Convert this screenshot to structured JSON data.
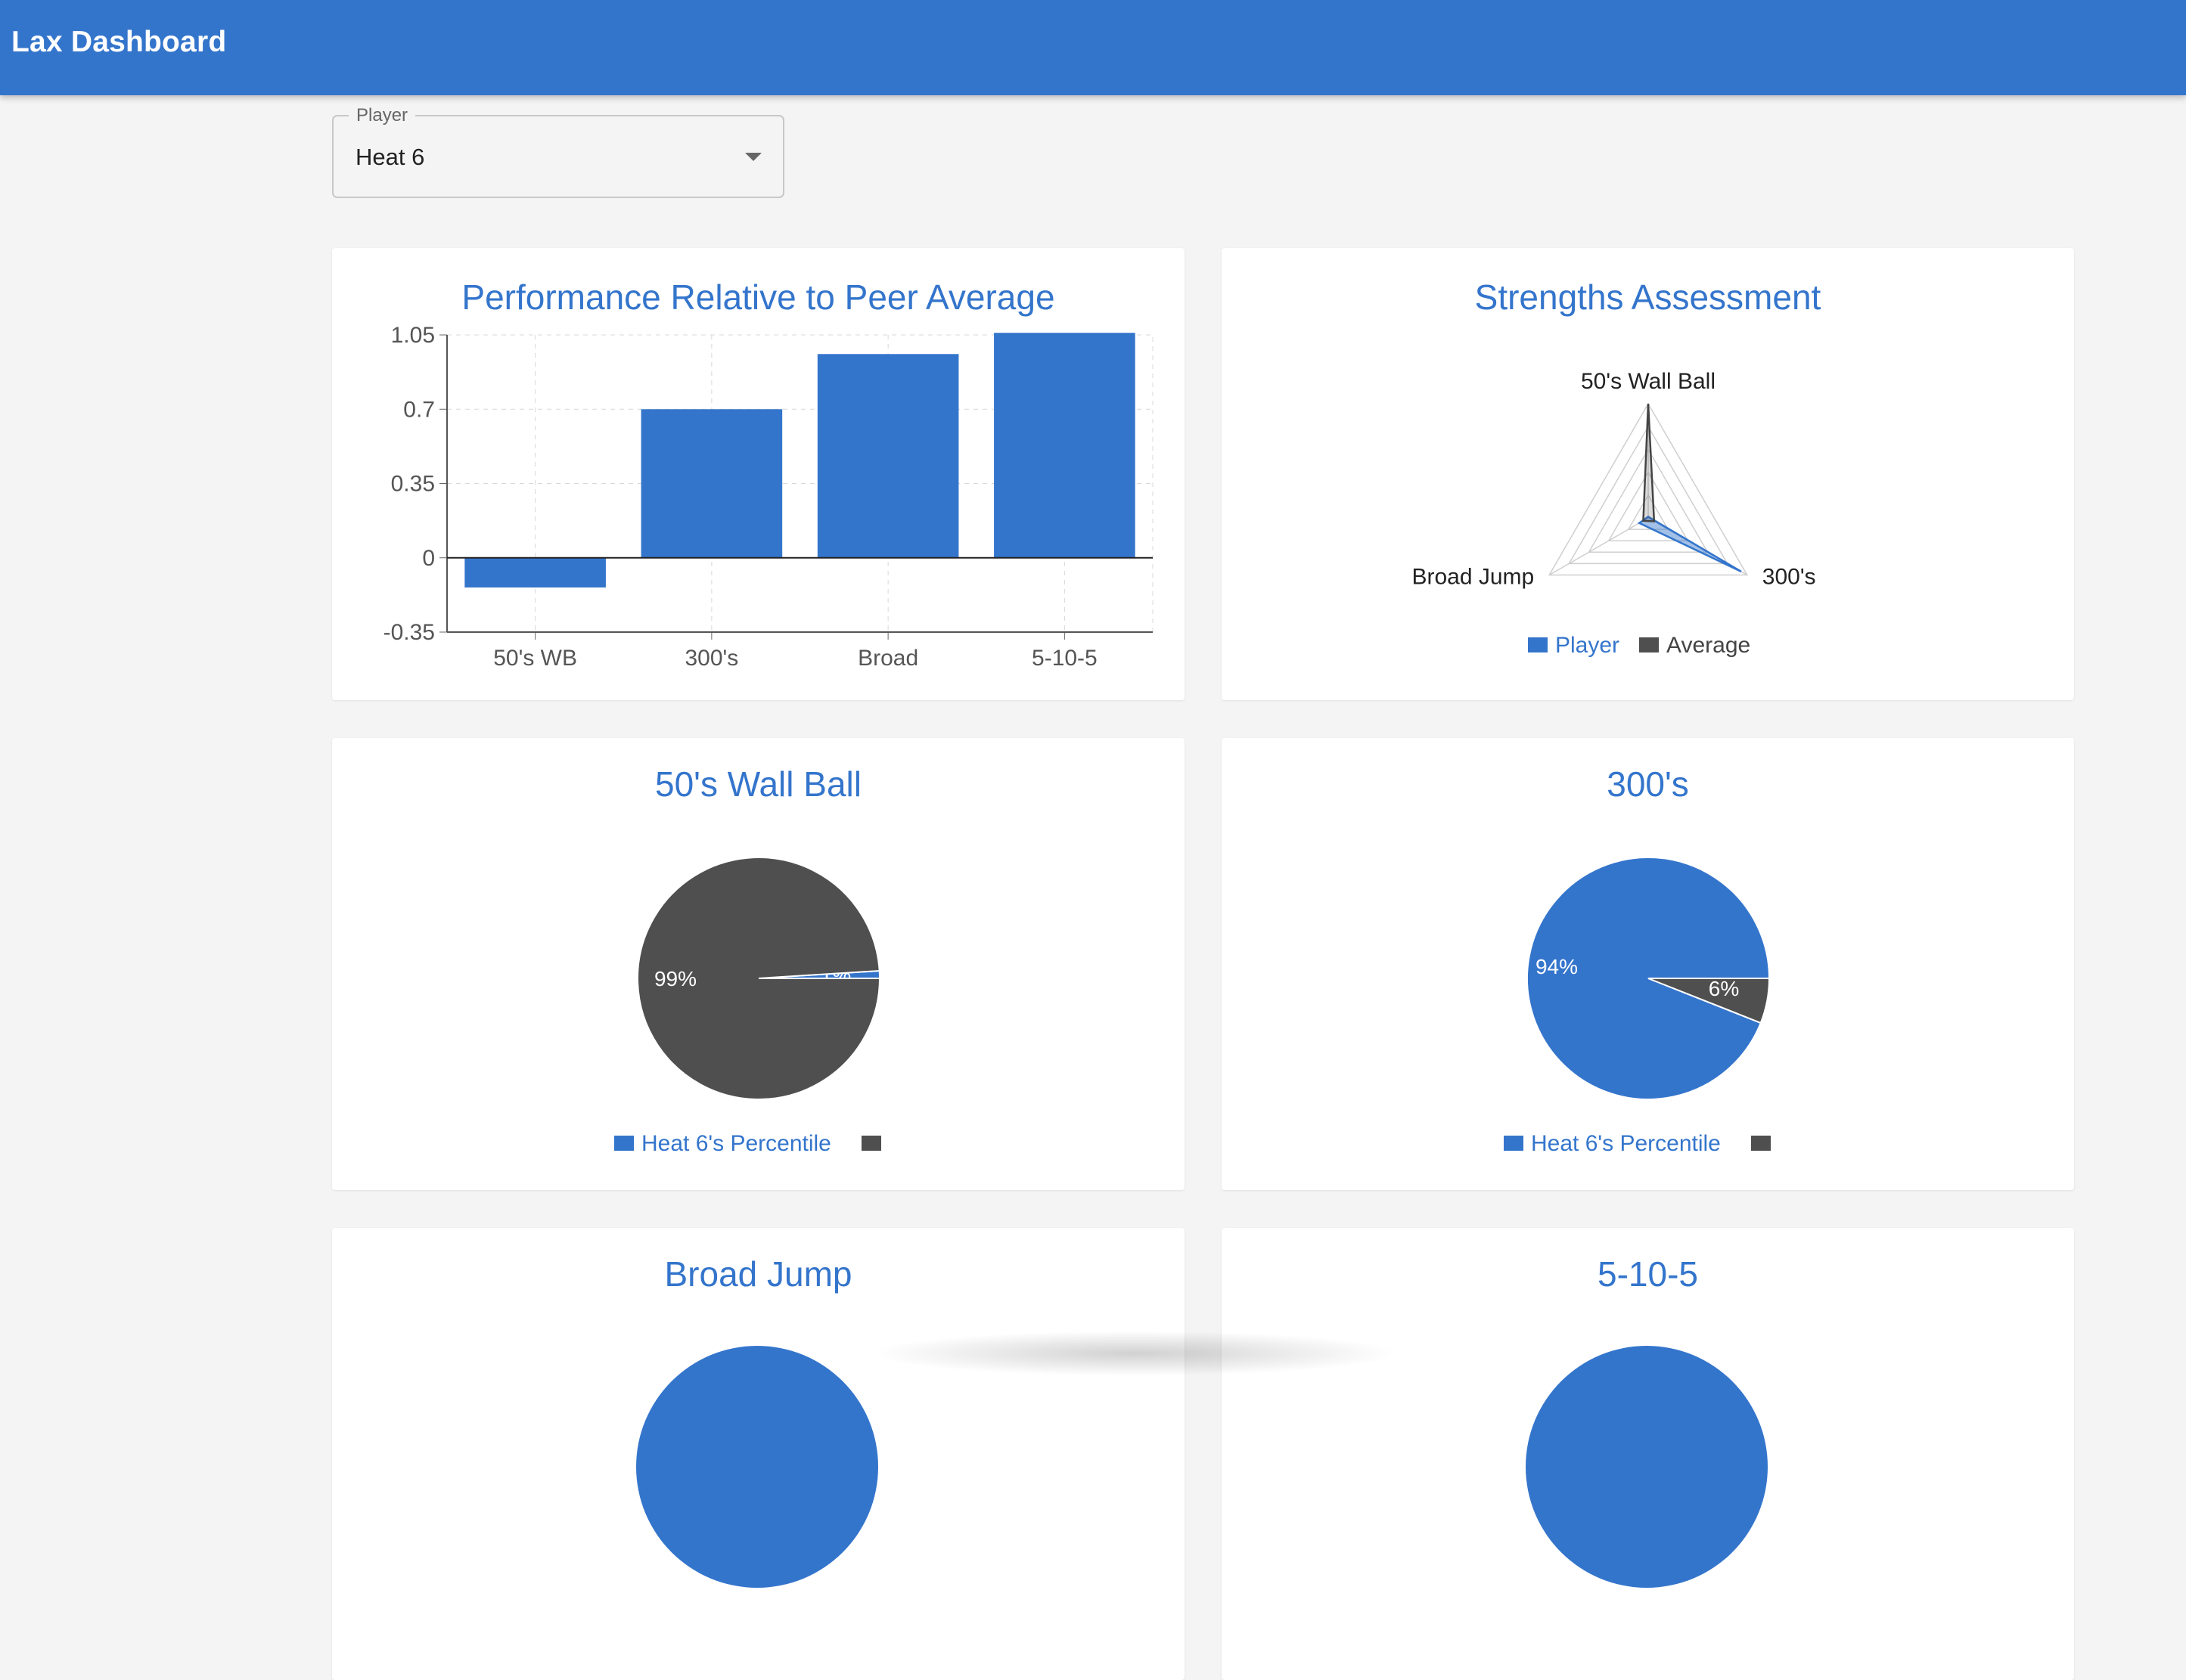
{
  "app": {
    "title": "Lax Dashboard"
  },
  "player_select": {
    "label": "Player",
    "value": "Heat 6"
  },
  "colors": {
    "primary": "#3475cc",
    "secondary": "#4f4f4f",
    "background": "#f4f4f4"
  },
  "icons": {
    "dropdown": "chevron-down-icon"
  },
  "chart_data": [
    {
      "type": "bar",
      "title": "Performance Relative to Peer Average",
      "categories": [
        "50's WB",
        "300's",
        "Broad",
        "5-10-5"
      ],
      "values": [
        -0.14,
        0.7,
        0.96,
        1.06
      ],
      "ylim": [
        -0.35,
        1.05
      ],
      "yticks": [
        "1.05",
        "0.7",
        "0.35",
        "0",
        "-0.35"
      ],
      "grid": true
    },
    {
      "type": "radar",
      "title": "Strengths Assessment",
      "axes": [
        "50's Wall Ball",
        "300's",
        "Broad Jump"
      ],
      "series": [
        {
          "name": "Player",
          "values": [
            0.01,
            0.94,
            0.09
          ]
        },
        {
          "name": "Average",
          "values": [
            1.0,
            0.06,
            0.05
          ]
        }
      ],
      "legend": "bottom"
    },
    {
      "type": "pie",
      "title": "50's Wall Ball",
      "slices": [
        {
          "label": "Heat 6's Percentile",
          "value": 1,
          "text": "1%"
        },
        {
          "label": "",
          "value": 99,
          "text": "99%"
        }
      ],
      "legend": "bottom"
    },
    {
      "type": "pie",
      "title": "300's",
      "slices": [
        {
          "label": "Heat 6's Percentile",
          "value": 94,
          "text": "94%"
        },
        {
          "label": "",
          "value": 6,
          "text": "6%"
        }
      ],
      "legend": "bottom"
    },
    {
      "type": "pie",
      "title": "Broad Jump"
    },
    {
      "type": "pie",
      "title": "5-10-5"
    }
  ]
}
